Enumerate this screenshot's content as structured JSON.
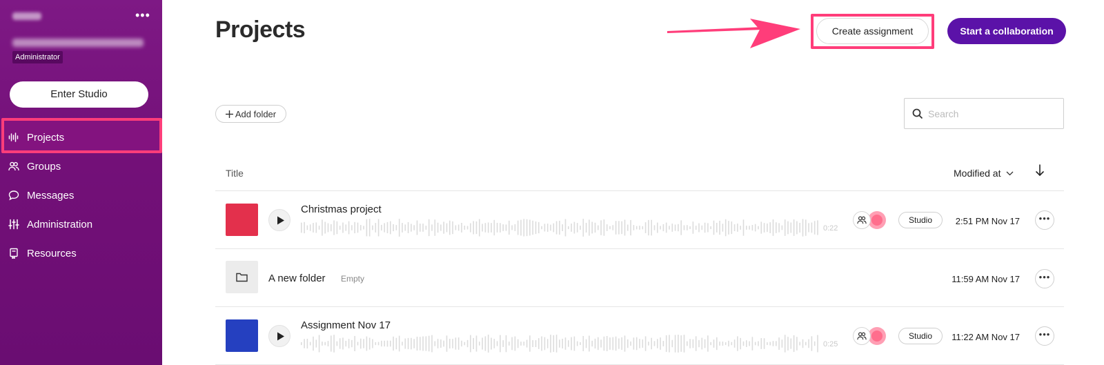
{
  "sidebar": {
    "role_badge": "Administrator",
    "enter_studio_label": "Enter Studio",
    "more_label": "•••",
    "items": [
      {
        "label": "Projects",
        "icon": "waveform-icon",
        "active": true
      },
      {
        "label": "Groups",
        "icon": "groups-icon"
      },
      {
        "label": "Messages",
        "icon": "message-bubble-icon"
      },
      {
        "label": "Administration",
        "icon": "sliders-icon"
      },
      {
        "label": "Resources",
        "icon": "book-icon"
      }
    ]
  },
  "header": {
    "title": "Projects",
    "create_assignment_label": "Create assignment",
    "start_collaboration_label": "Start a collaboration"
  },
  "toolbar": {
    "add_folder_label": "Add folder",
    "search_placeholder": "Search"
  },
  "table": {
    "col_title": "Title",
    "col_modified": "Modified at",
    "rows": [
      {
        "type": "project",
        "title": "Christmas project",
        "thumb_color": "#e3304c",
        "duration": "0:22",
        "badge": "Studio",
        "modified": "2:51 PM Nov 17",
        "more": "•••"
      },
      {
        "type": "folder",
        "title": "A new folder",
        "status": "Empty",
        "modified": "11:59 AM Nov 17",
        "more": "•••"
      },
      {
        "type": "project",
        "title": "Assignment Nov 17",
        "thumb_color": "#2540c0",
        "duration": "0:25",
        "badge": "Studio",
        "modified": "11:22 AM Nov 17",
        "more": "•••"
      }
    ]
  },
  "colors": {
    "sidebar_bg": "#7a1580",
    "accent": "#5b12a8",
    "highlight": "#ff3d7a"
  }
}
